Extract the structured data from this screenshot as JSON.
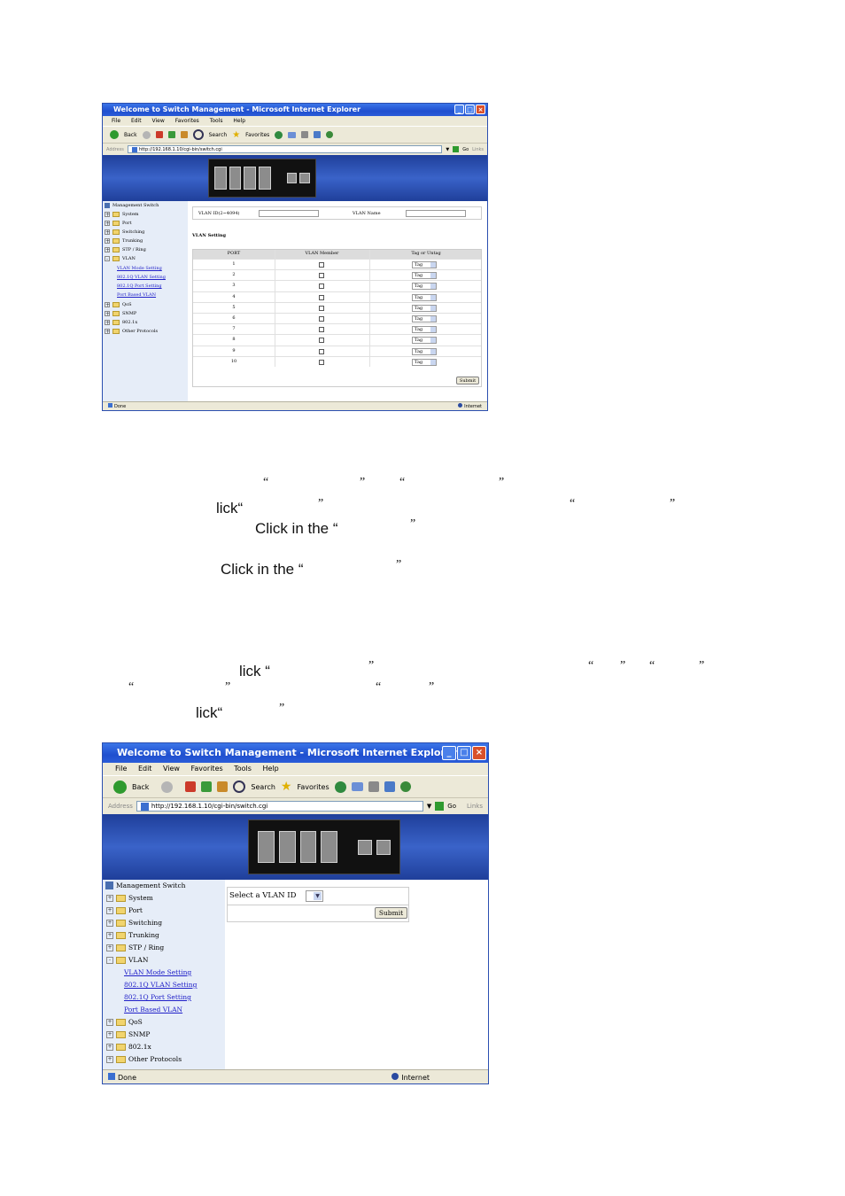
{
  "window1": {
    "title": "Welcome to Switch Management - Microsoft Internet Explorer",
    "menu": [
      "File",
      "Edit",
      "View",
      "Favorites",
      "Tools",
      "Help"
    ],
    "toolbar": {
      "back": "Back",
      "search": "Search",
      "favorites": "Favorites"
    },
    "address_label": "Address",
    "url": "http://192.168.1.10/cgi-bin/switch.cgi",
    "go": "Go",
    "links": "Links",
    "tree": {
      "root": "Management Switch",
      "items": [
        "System",
        "Port",
        "Switching",
        "Trunking",
        "STP / Ring",
        "VLAN"
      ],
      "vlan_children": [
        "VLAN Mode Setting",
        "802.1Q VLAN Setting",
        "802.1Q Port Setting",
        "Port Based VLAN"
      ],
      "items_after": [
        "QoS",
        "SNMP",
        "802.1x",
        "Other Protocols"
      ]
    },
    "form": {
      "vlan_id_label": "VLAN ID(2~4094)",
      "vlan_name_label": "VLAN Name",
      "section_title": "VLAN Setting",
      "columns": [
        "PORT",
        "VLAN Member",
        "Tag or Untag"
      ],
      "rows": [
        {
          "port": "1",
          "tag": "Tag"
        },
        {
          "port": "2",
          "tag": "Tag"
        },
        {
          "port": "3",
          "tag": "Tag"
        },
        {
          "port": "4",
          "tag": "Tag"
        },
        {
          "port": "5",
          "tag": "Tag"
        },
        {
          "port": "6",
          "tag": "Tag"
        },
        {
          "port": "7",
          "tag": "Tag"
        },
        {
          "port": "8",
          "tag": "Tag"
        },
        {
          "port": "9",
          "tag": "Tag"
        },
        {
          "port": "10",
          "tag": "Tag"
        }
      ],
      "submit": "Submit"
    },
    "status_left": "Done",
    "status_right": "Internet"
  },
  "text_lines": [
    {
      "id": "l2",
      "text": "lick“"
    },
    {
      "id": "l3",
      "text": "Click in the “"
    },
    {
      "id": "l4",
      "text": "Click in the “"
    },
    {
      "id": "l5",
      "text": "lick “"
    },
    {
      "id": "l7",
      "text": "lick“"
    }
  ],
  "window2": {
    "title": "Welcome to Switch Management - Microsoft Internet Explorer",
    "menu": [
      "File",
      "Edit",
      "View",
      "Favorites",
      "Tools",
      "Help"
    ],
    "toolbar": {
      "back": "Back",
      "search": "Search",
      "favorites": "Favorites"
    },
    "address_label": "Address",
    "url": "http://192.168.1.10/cgi-bin/switch.cgi",
    "go": "Go",
    "links": "Links",
    "tree": {
      "root": "Management Switch",
      "items": [
        "System",
        "Port",
        "Switching",
        "Trunking",
        "STP / Ring",
        "VLAN"
      ],
      "vlan_children": [
        "VLAN Mode Setting",
        "802.1Q VLAN Setting",
        "802.1Q Port Setting",
        "Port Based VLAN"
      ],
      "items_after": [
        "QoS",
        "SNMP",
        "802.1x",
        "Other Protocols"
      ]
    },
    "form": {
      "select_label": "Select a VLAN ID",
      "submit": "Submit"
    },
    "status_left": "Done",
    "status_right": "Internet"
  }
}
